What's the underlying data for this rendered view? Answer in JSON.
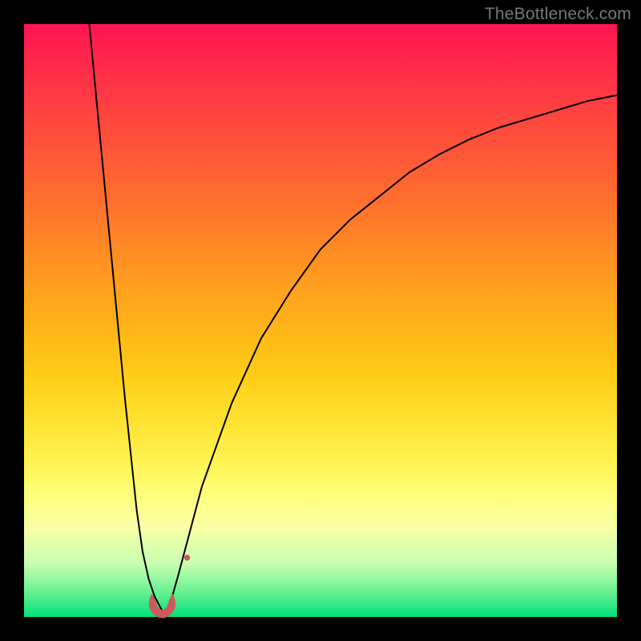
{
  "watermark": "TheBottleneck.com",
  "colors": {
    "frame": "#000000",
    "curve": "#000000",
    "marker": "#cc5a5d",
    "gradient_stops": [
      "#ff1452",
      "#ff2a4a",
      "#ff4340",
      "#ff5d35",
      "#ff7a2a",
      "#ff9820",
      "#ffb418",
      "#ffcf18",
      "#ffe73a",
      "#fff85f",
      "#feff80",
      "#f8ffa6",
      "#c8ffb0",
      "#63f090",
      "#00e17a"
    ]
  },
  "chart_data": {
    "type": "line",
    "title": "",
    "xlabel": "",
    "ylabel": "",
    "xlim": [
      0,
      100
    ],
    "ylim": [
      0,
      100
    ],
    "grid": false,
    "legend": false,
    "series": [
      {
        "name": "left-branch",
        "x": [
          11,
          13,
          15,
          17,
          19,
          20,
          21,
          22,
          23,
          23.5,
          24
        ],
        "y": [
          100,
          79,
          58,
          37,
          18,
          11,
          6.5,
          3.5,
          1.6,
          0.8,
          0
        ]
      },
      {
        "name": "right-branch",
        "x": [
          24,
          26,
          30,
          35,
          40,
          45,
          50,
          55,
          60,
          65,
          70,
          75,
          80,
          85,
          90,
          95,
          100
        ],
        "y": [
          0,
          7,
          22,
          36,
          47,
          55,
          62,
          67,
          71,
          75,
          78,
          80.5,
          82.5,
          84,
          85.5,
          87,
          88
        ]
      }
    ],
    "markers": [
      {
        "name": "valley-blob",
        "x": 23.3,
        "y": 2.2,
        "shape": "u-blob",
        "size": 3.2
      },
      {
        "name": "right-dot",
        "x": 27.5,
        "y": 10,
        "shape": "dot",
        "size": 1.0
      }
    ]
  }
}
